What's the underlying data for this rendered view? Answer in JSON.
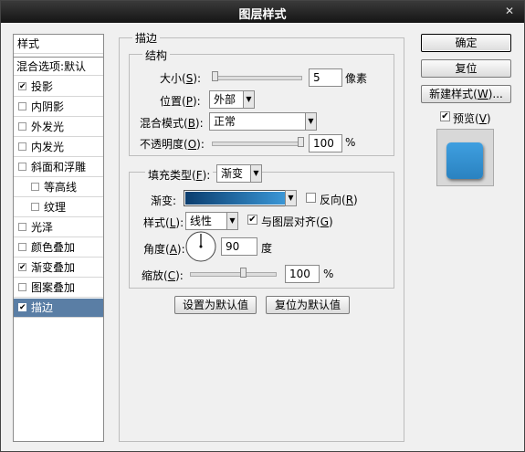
{
  "window": {
    "title": "图层样式",
    "close_glyph": "✕"
  },
  "sidebar": {
    "items": [
      {
        "label": "样式",
        "checkbox": false,
        "checked": false
      },
      {
        "label": "混合选项:默认",
        "checkbox": false,
        "checked": false
      },
      {
        "label": "投影",
        "checkbox": true,
        "checked": true
      },
      {
        "label": "内阴影",
        "checkbox": true,
        "checked": false
      },
      {
        "label": "外发光",
        "checkbox": true,
        "checked": false
      },
      {
        "label": "内发光",
        "checkbox": true,
        "checked": false
      },
      {
        "label": "斜面和浮雕",
        "checkbox": true,
        "checked": false
      },
      {
        "label": "等高线",
        "checkbox": true,
        "checked": false
      },
      {
        "label": "纹理",
        "checkbox": true,
        "checked": false
      },
      {
        "label": "光泽",
        "checkbox": true,
        "checked": false
      },
      {
        "label": "颜色叠加",
        "checkbox": true,
        "checked": false
      },
      {
        "label": "渐变叠加",
        "checkbox": true,
        "checked": true
      },
      {
        "label": "图案叠加",
        "checkbox": true,
        "checked": false
      },
      {
        "label": "描边",
        "checkbox": true,
        "checked": true
      }
    ],
    "check_glyph": "✔"
  },
  "stroke": {
    "section_title": "描边",
    "structure_title": "结构",
    "size_label": "大小(",
    "size_key": "S",
    "size_value": "5",
    "size_unit": "像素",
    "position_label": "位置(",
    "position_key": "P",
    "position_value": "外部",
    "blend_label": "混合模式(",
    "blend_key": "B",
    "blend_value": "正常",
    "opacity_label": "不透明度(",
    "opacity_key": "O",
    "opacity_value": "100",
    "opacity_unit": "%",
    "fill_type_label": "填充类型(",
    "fill_type_key": "F",
    "fill_type_value": "渐变",
    "gradient_label": "渐变:",
    "reverse_label": "反向(",
    "reverse_key": "R",
    "style_label": "样式(",
    "style_key": "L",
    "style_value": "线性",
    "align_label": "与图层对齐(",
    "align_key": "G",
    "angle_label": "角度(",
    "angle_key": "A",
    "angle_value": "90",
    "angle_unit": "度",
    "scale_label": "缩放(",
    "scale_key": "C",
    "scale_value": "100",
    "scale_unit": "%",
    "close_paren": ")",
    "colon": ":",
    "set_default": "设置为默认值",
    "reset_default": "复位为默认值",
    "gradient_colors": [
      "#0b3d6e",
      "#3f9fe0"
    ]
  },
  "buttons": {
    "ok": "确定",
    "reset": "复位",
    "new_style": "新建样式(",
    "new_style_key": "W",
    "new_style_tail": ")...",
    "preview": "预览(",
    "preview_key": "V"
  },
  "preview_colors": {
    "swatch": "#2a82c0"
  },
  "glyphs": {
    "dropdown": "▼",
    "check": "✔"
  }
}
